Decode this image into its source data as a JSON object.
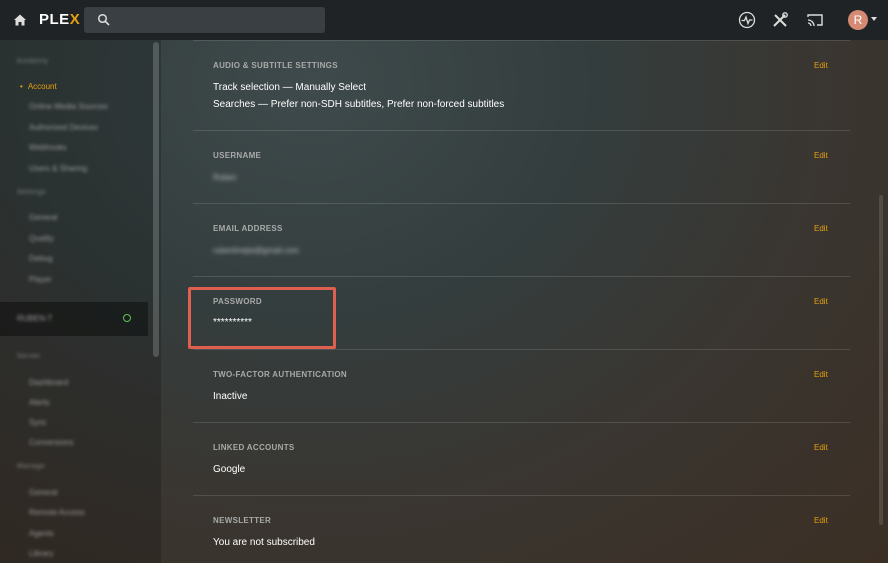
{
  "app": {
    "logo_text": "PLE",
    "logo_accent": "X",
    "accent_color": "#e5a00d",
    "user_initial": "R"
  },
  "topbar": {
    "search_placeholder": "",
    "icons": [
      "home-icon",
      "search-icon",
      "activity-icon",
      "settings-tools-icon",
      "cast-icon"
    ]
  },
  "sidebar": {
    "active_item": "Account",
    "headers": [
      "Kimberly",
      "Settings",
      "Server",
      "Manage"
    ],
    "items_group1": [
      "Online Media Sources",
      "Authorized Devices",
      "Webhooks",
      "Users & Sharing"
    ],
    "items_group2": [
      "General",
      "Quality",
      "Debug",
      "Player"
    ],
    "server_name": "RUBEN-T",
    "items_group3": [
      "Dashboard",
      "Alerts",
      "Sync",
      "Conversions"
    ],
    "items_group4": [
      "General",
      "Remote Access",
      "Agents",
      "Library"
    ]
  },
  "sections": [
    {
      "label": "AUDIO & SUBTITLE SETTINGS",
      "edit": "Edit",
      "lines": [
        "Track selection  —  Manually Select",
        "Searches  —  Prefer non-SDH subtitles, Prefer non-forced subtitles"
      ]
    },
    {
      "label": "USERNAME",
      "edit": "Edit",
      "value": "Ruben"
    },
    {
      "label": "EMAIL ADDRESS",
      "edit": "Edit",
      "value": "rubenlmejia@gmail.com"
    },
    {
      "label": "PASSWORD",
      "edit": "Edit",
      "value": "**********"
    },
    {
      "label": "TWO-FACTOR AUTHENTICATION",
      "edit": "Edit",
      "value": "Inactive"
    },
    {
      "label": "LINKED ACCOUNTS",
      "edit": "Edit",
      "value": "Google"
    },
    {
      "label": "NEWSLETTER",
      "edit": "Edit",
      "value": "You are not subscribed"
    }
  ]
}
